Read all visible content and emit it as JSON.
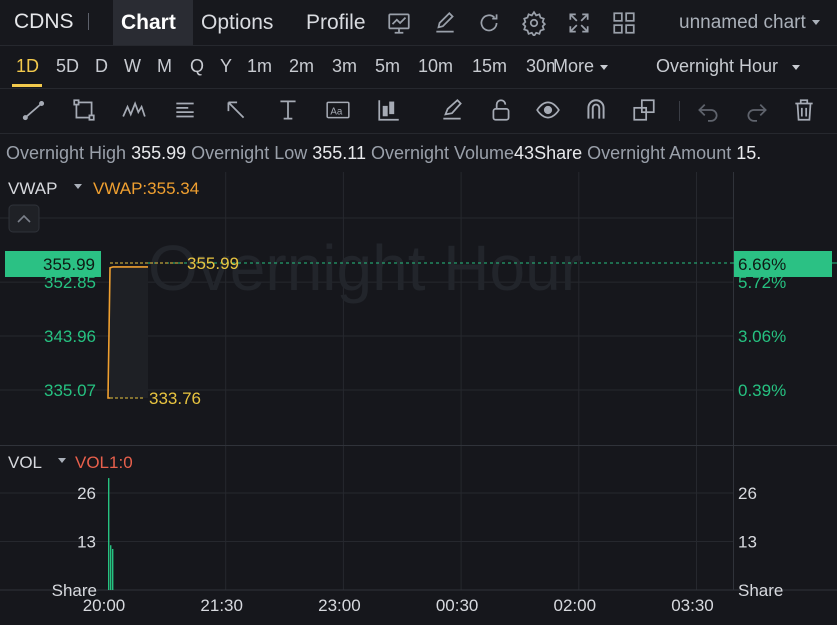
{
  "topbar": {
    "ticker": "CDNS",
    "tabs": [
      {
        "label": "Chart",
        "active": true
      },
      {
        "label": "Options",
        "active": false
      },
      {
        "label": "Profile",
        "active": false
      }
    ],
    "icons": [
      "chart-window-icon",
      "edit-icon",
      "refresh-icon",
      "settings-icon",
      "fullscreen-icon",
      "layout-grid-icon"
    ],
    "chart_name": "unnamed chart"
  },
  "periods": {
    "items": [
      "1D",
      "5D",
      "D",
      "W",
      "M",
      "Q",
      "Y",
      "1m",
      "2m",
      "3m",
      "5m",
      "10m",
      "15m",
      "30m"
    ],
    "active": "1D",
    "more_label": "More",
    "session_label": "Overnight Hour"
  },
  "tools": [
    "trend-line-icon",
    "rectangle-icon",
    "pattern-icon",
    "fib-icon",
    "arrow-icon",
    "measure-icon",
    "text-icon",
    "indicator-icon",
    "brush-icon",
    "lock-icon",
    "eye-icon",
    "magnet-icon",
    "layers-icon",
    "undo-icon",
    "redo-icon",
    "delete-icon"
  ],
  "info": {
    "high_label": "Overnight High",
    "high_value": "355.99",
    "low_label": "Overnight Low",
    "low_value": "355.11",
    "volume_label": "Overnight Volume",
    "volume_value": "43Share",
    "amount_label": "Overnight Amount",
    "amount_value": "15."
  },
  "main_pane": {
    "indicator_label": "VWAP",
    "vwap_label": "VWAP:355.34",
    "watermark": "Overnight Hour",
    "current_price": "355.99",
    "current_pct": "6.66%",
    "high_marker": "355.99",
    "low_marker": "333.76"
  },
  "volume_pane": {
    "indicator_label": "VOL",
    "vol_label": "VOL1:0",
    "unit": "Share"
  },
  "colors": {
    "accent": "#f2c94c",
    "up": "#26c281",
    "vwap": "#f0a030",
    "vol_label": "#e8604c",
    "price_tag": "#2bc184"
  },
  "chart_data": [
    {
      "type": "line",
      "title": "",
      "series": [
        {
          "name": "VWAP",
          "x": [
            "20:00",
            "20:02",
            "20:05",
            "20:30"
          ],
          "values": [
            333.76,
            355.2,
            355.34,
            355.34
          ]
        }
      ],
      "markers": {
        "high": 355.99,
        "low": 333.76,
        "current": 355.99
      },
      "y_ticks": [
        352.85,
        343.96,
        335.07
      ],
      "y_pct_ticks": [
        "5.72%",
        "3.06%",
        "0.39%"
      ],
      "ylim": [
        331.5,
        359.5
      ],
      "x_ticks": [
        "20:00",
        "21:30",
        "23:00",
        "00:30",
        "02:00",
        "03:30"
      ],
      "grid": true
    },
    {
      "type": "bar",
      "title": "",
      "series": [
        {
          "name": "VOL",
          "x": [
            "20:00",
            "20:01",
            "20:02"
          ],
          "values": [
            30,
            12,
            11
          ]
        }
      ],
      "y_ticks": [
        26,
        13
      ],
      "ylim": [
        0,
        32
      ],
      "x_ticks": [
        "20:00",
        "21:30",
        "23:00",
        "00:30",
        "02:00",
        "03:30"
      ],
      "grid": true
    }
  ]
}
